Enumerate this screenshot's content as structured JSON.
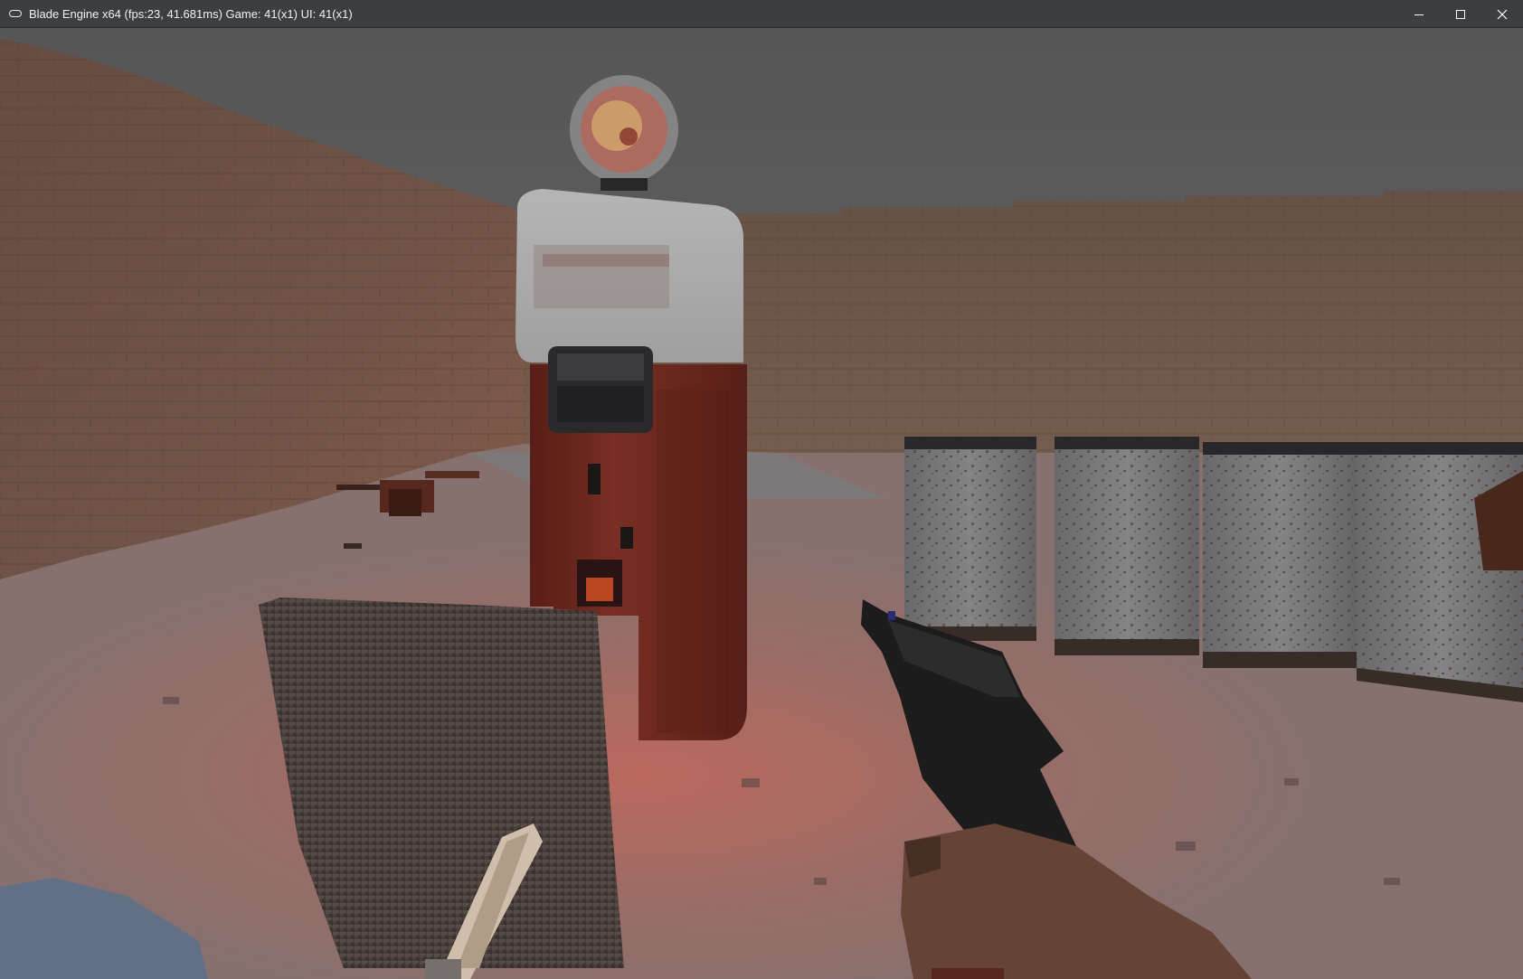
{
  "window": {
    "title": "Blade Engine x64 (fps:23, 41.681ms) Game: 41(x1) UI: 41(x1)",
    "icon": "gamepad-icon",
    "controls": [
      {
        "name": "minimize",
        "icon": "minimize-icon"
      },
      {
        "name": "maximize",
        "icon": "maximize-icon"
      },
      {
        "name": "close",
        "icon": "close-icon"
      }
    ]
  },
  "scene": {
    "type": "first-person 3D view",
    "colors": {
      "sky": "#5e5e5e",
      "brick_wall": "#6e5446",
      "floor": "#8e6e6a",
      "floor_glow": "#c07064",
      "vending_machine_body": "#7a2e22",
      "vending_machine_top": "#b4b4b4",
      "barrels": "#7e7e80",
      "crate": "#4e4440",
      "pistol": "#1e1e1e",
      "hand": "#6a4638"
    }
  }
}
